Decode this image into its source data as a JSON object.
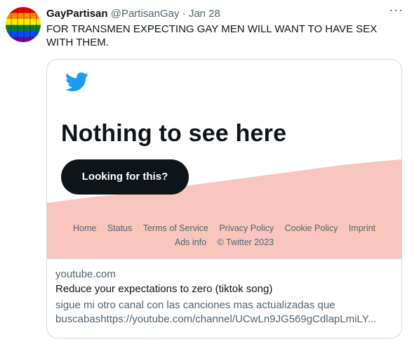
{
  "tweet": {
    "author_name": "GayPartisan",
    "handle": "@PartisanGay",
    "separator": "·",
    "date": "Jan 28",
    "more_icon": "more-horizontal-icon",
    "text": "FOR TRANSMEN EXPECTING GAY MEN WILL WANT TO HAVE SEX WITH THEM."
  },
  "card": {
    "preview": {
      "logo_icon": "twitter-bird-icon",
      "headline": "Nothing to see here",
      "cta_label": "Looking for this?",
      "footer_links": [
        "Home",
        "Status",
        "Terms of Service",
        "Privacy Policy",
        "Cookie Policy",
        "Imprint",
        "Ads info",
        "© Twitter 2023"
      ]
    },
    "domain": "youtube.com",
    "title": "Reduce your expectations to zero (tiktok song)",
    "description_line1": "sigue mi otro canal con las canciones mas actualizadas que",
    "description_line2": "buscabashttps://youtube.com/channel/UCwLn9JG569gCdlapLmiLY..."
  },
  "colors": {
    "twitter_blue": "#1d9bf0",
    "pink_band": "#f8c6bd",
    "cta_bg": "#0f1419",
    "muted_text": "#536471",
    "border": "#cfd9de"
  }
}
